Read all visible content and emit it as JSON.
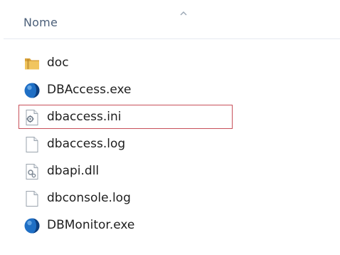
{
  "list_header": {
    "column_label": "Nome",
    "sort_indicator": "ascending"
  },
  "files": [
    {
      "name": "doc",
      "type": "folder",
      "icon": "folder-icon",
      "selected": false
    },
    {
      "name": "DBAccess.exe",
      "type": "application",
      "icon": "app-globe-icon",
      "selected": false
    },
    {
      "name": "dbaccess.ini",
      "type": "configuration",
      "icon": "config-file-icon",
      "selected": true
    },
    {
      "name": "dbaccess.log",
      "type": "text",
      "icon": "text-file-icon",
      "selected": false
    },
    {
      "name": "dbapi.dll",
      "type": "library",
      "icon": "dll-file-icon",
      "selected": false
    },
    {
      "name": "dbconsole.log",
      "type": "text",
      "icon": "text-file-icon",
      "selected": false
    },
    {
      "name": "DBMonitor.exe",
      "type": "application",
      "icon": "app-globe-icon",
      "selected": false
    }
  ],
  "colors": {
    "header_text": "#4c607a",
    "file_text": "#1e1e1e",
    "selection_border": "#c8505a",
    "folder": "#e8b64a",
    "app_icon": "#1f6fc5"
  }
}
